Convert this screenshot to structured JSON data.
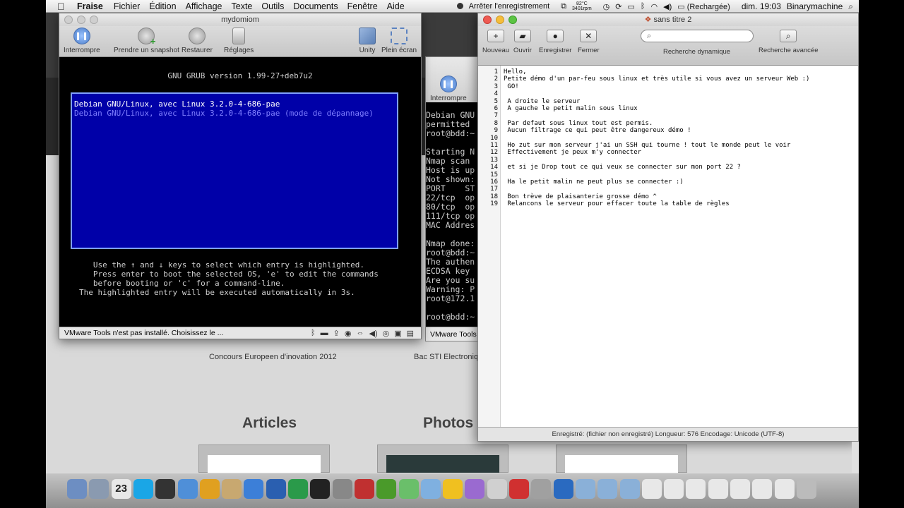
{
  "menubar": {
    "apple": "",
    "app": "Fraise",
    "items": [
      "Fichier",
      "Édition",
      "Affichage",
      "Texte",
      "Outils",
      "Documents",
      "Fenêtre",
      "Aide"
    ],
    "recording": "Arrêter l'enregistrement",
    "temp": "82°C",
    "rpm": "3401rpm",
    "battery": "(Rechargée)",
    "clock": "dim. 19:03",
    "user": "Binarymachine"
  },
  "webpage": {
    "captions": [
      "Concours Europeen d'inovation 2012",
      "Bac STI Electronique"
    ],
    "sections": [
      "Articles",
      "Photos"
    ]
  },
  "vm_main": {
    "title": "mydomiom",
    "toolbar": [
      "Interrompre",
      "Prendre un snapshot",
      "Restaurer",
      "Réglages",
      "Unity",
      "Plein écran"
    ],
    "grub_title": "GNU GRUB  version 1.99-27+deb7u2",
    "entries": [
      "Debian GNU/Linux, avec Linux 3.2.0-4-686-pae",
      "Debian GNU/Linux, avec Linux 3.2.0-4-686-pae (mode de dépannage)"
    ],
    "help": "   Use the ↑ and ↓ keys to select which entry is highlighted.\n   Press enter to boot the selected OS, 'e' to edit the commands\n   before booting or 'c' for a command-line.\nThe highlighted entry will be executed automatically in 3s.",
    "status": "VMware Tools n'est pas installé. Choisissez le ..."
  },
  "vm_second": {
    "toolbar": "Interrompre",
    "console": "Debian GNU\npermitted \nroot@bdd:~\n\nStarting N\nNmap scan \nHost is up\nNot shown:\nPORT    ST\n22/tcp  op\n80/tcp  op\n111/tcp op\nMAC Addres\n\nNmap done:\nroot@bdd:~\nThe authen\nECDSA key \nAre you su\nWarning: P\nroot@172.1\n\nroot@bdd:~",
    "status": "VMware Tools"
  },
  "fraise": {
    "title": "sans titre 2",
    "toolbar": [
      "Nouveau",
      "Ouvrir",
      "Enregistrer",
      "Fermer"
    ],
    "search_dynamic": "Recherche dynamique",
    "search_advanced": "Recherche avancée",
    "lines": [
      "Hello,",
      "Petite démo d'un par-feu sous linux et très utile si vous avez un serveur Web :)",
      " GO!",
      "",
      " A droite le serveur",
      " A gauche le petit malin sous linux",
      "",
      " Par defaut sous linux tout est permis.",
      " Aucun filtrage ce qui peut être dangereux démo !",
      "",
      " Ho zut sur mon serveur j'ai un SSH qui tourne ! tout le monde peut le voir",
      " Effectivement je peux m'y connecter",
      "",
      " et si je Drop tout ce qui veux se connecter sur mon port 22 ?",
      "",
      " Ha le petit malin ne peut plus se connecter :)",
      "",
      " Bon trève de plaisanterie grosse démo ^",
      " Relancons le serveur pour effacer toute la table de règles"
    ],
    "status": "Enregistré: (fichier non enregistré)   Longueur: 576   Encodage: Unicode (UTF-8)"
  },
  "dock": {
    "icons": [
      "finder-icon",
      "preview-icon",
      "calendar-icon",
      "skype-icon",
      "phone-icon",
      "safari-icon",
      "chrome-icon",
      "contacts-icon",
      "itunes-icon",
      "word-icon",
      "excel-icon",
      "terminal-icon",
      "system-prefs-icon",
      "vmware-icon",
      "qt-icon",
      "frog-icon",
      "cube-icon",
      "brackets-icon",
      "orb-icon",
      "script-icon",
      "fraise-icon",
      "photos-icon",
      "quicktime-icon",
      "folder-icon",
      "folder-icon",
      "folder-icon",
      "window-icon",
      "window-icon",
      "window-icon",
      "window-icon",
      "window-icon",
      "window-icon",
      "window-icon",
      "trash-icon"
    ],
    "calendar_day": "23",
    "colors": [
      "#6d8ec2",
      "#8a9ab0",
      "#e8e8e8",
      "#1aa6e6",
      "#333333",
      "#4f8fd8",
      "#e0a020",
      "#c8a870",
      "#3c7fd8",
      "#2a5fb0",
      "#2a9a4a",
      "#222222",
      "#888888",
      "#c03030",
      "#4a9a2a",
      "#6abf6a",
      "#7fb0e0",
      "#f0c020",
      "#9a6ad0",
      "#d0d0d0",
      "#d03030",
      "#a0a0a0",
      "#2a6ac0",
      "#8ab0d8",
      "#8ab0d8",
      "#8ab0d8",
      "#e8e8e8",
      "#e8e8e8",
      "#e8e8e8",
      "#e8e8e8",
      "#e8e8e8",
      "#e8e8e8",
      "#e8e8e8",
      "#bbbbbb"
    ]
  }
}
